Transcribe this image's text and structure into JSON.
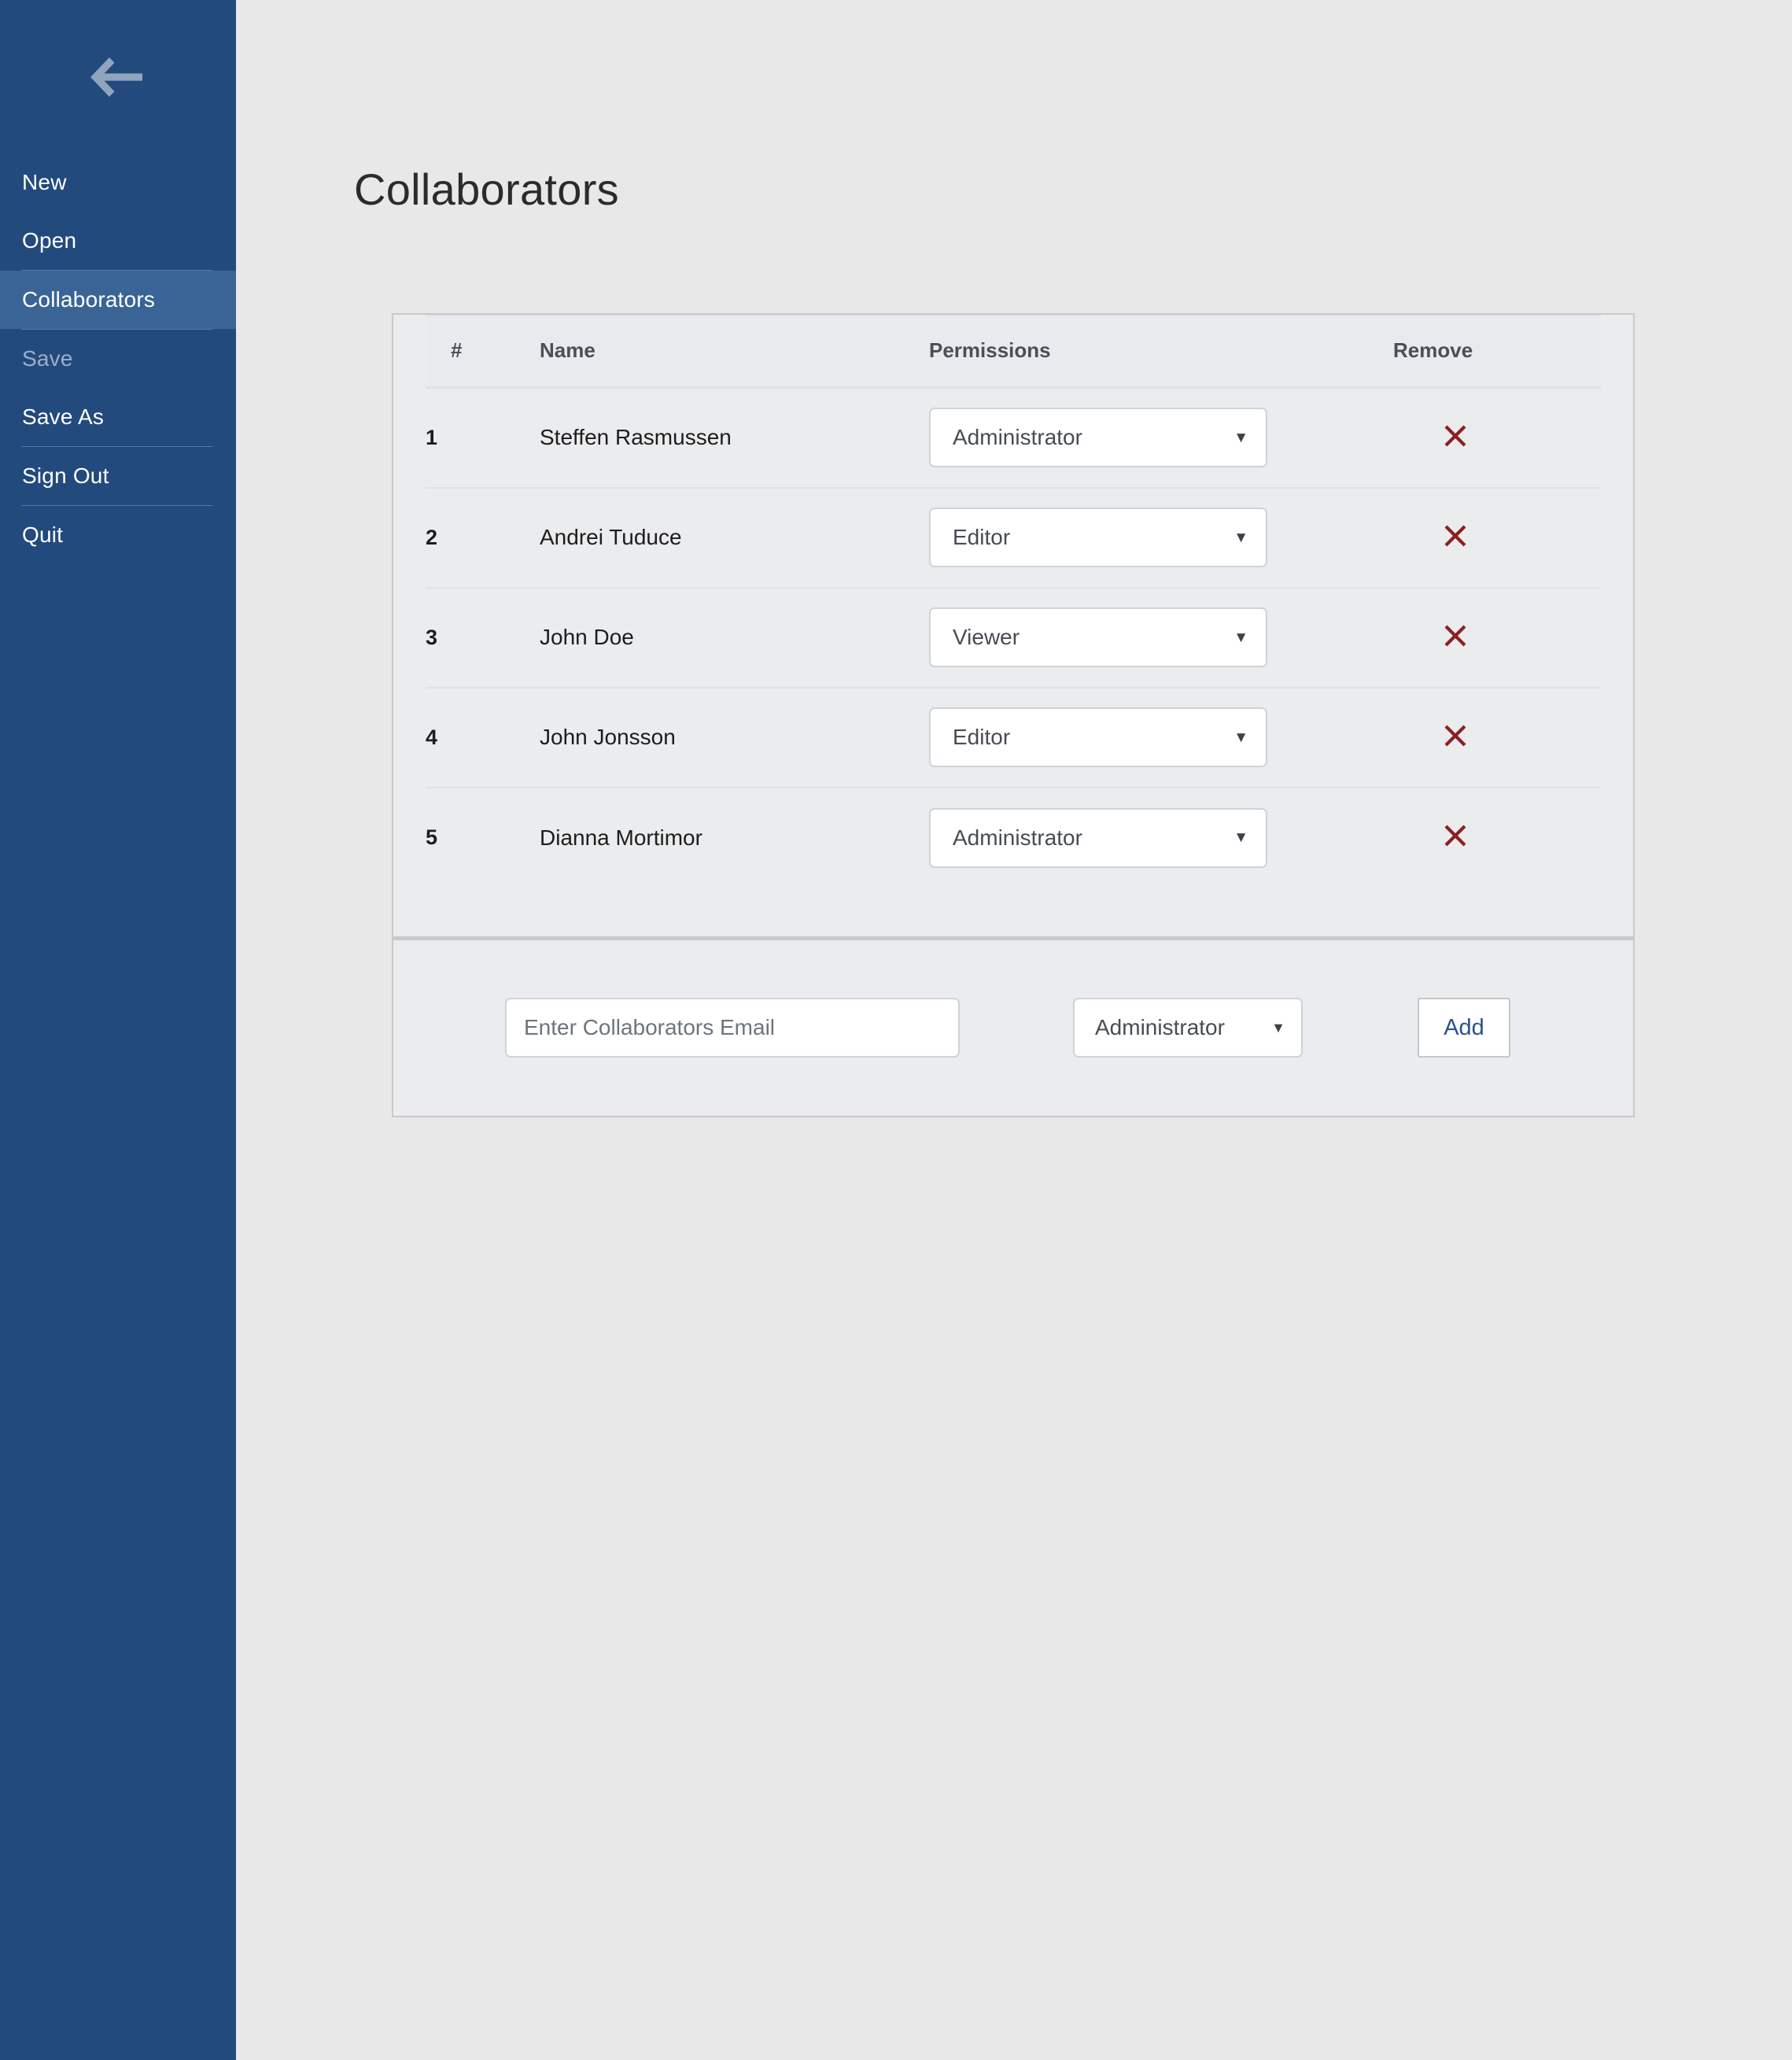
{
  "sidebar": {
    "back_icon": "back-arrow-icon",
    "items": [
      {
        "label": "New",
        "state": "normal",
        "divider_after": false
      },
      {
        "label": "Open",
        "state": "normal",
        "divider_after": true
      },
      {
        "label": "Collaborators",
        "state": "active",
        "divider_after": true
      },
      {
        "label": "Save",
        "state": "disabled",
        "divider_after": false
      },
      {
        "label": "Save As",
        "state": "normal",
        "divider_after": true
      },
      {
        "label": "Sign Out",
        "state": "normal",
        "divider_after": true
      },
      {
        "label": "Quit",
        "state": "normal",
        "divider_after": false
      }
    ],
    "colors": {
      "background": "#234a7d",
      "active_background": "#3a6496",
      "text": "#ffffff",
      "disabled_text": "#9bb0c8",
      "divider": "#5a7ba6",
      "back_arrow": "#8fa5bd"
    }
  },
  "page": {
    "title": "Collaborators",
    "background": "#e8e8e8"
  },
  "table": {
    "headers": {
      "number": "#",
      "name": "Name",
      "permissions": "Permissions",
      "remove": "Remove"
    },
    "rows": [
      {
        "num": "1",
        "name": "Steffen Rasmussen",
        "permission": "Administrator",
        "remove_icon": "close-x-icon"
      },
      {
        "num": "2",
        "name": "Andrei Tuduce",
        "permission": "Editor",
        "remove_icon": "close-x-icon"
      },
      {
        "num": "3",
        "name": "John Doe",
        "permission": "Viewer",
        "remove_icon": "close-x-icon"
      },
      {
        "num": "4",
        "name": "John Jonsson",
        "permission": "Editor",
        "remove_icon": "close-x-icon"
      },
      {
        "num": "5",
        "name": "Dianna Mortimor",
        "permission": "Administrator",
        "remove_icon": "close-x-icon"
      }
    ],
    "permission_options": [
      "Administrator",
      "Editor",
      "Viewer"
    ],
    "caret_glyph": "▼",
    "remove_icon_color": "#8b2020"
  },
  "add_form": {
    "email_value": "",
    "email_placeholder": "Enter Collaborators Email",
    "permission_value": "Administrator",
    "caret_glyph": "▼",
    "add_label": "Add",
    "add_label_color": "#2b5288"
  }
}
